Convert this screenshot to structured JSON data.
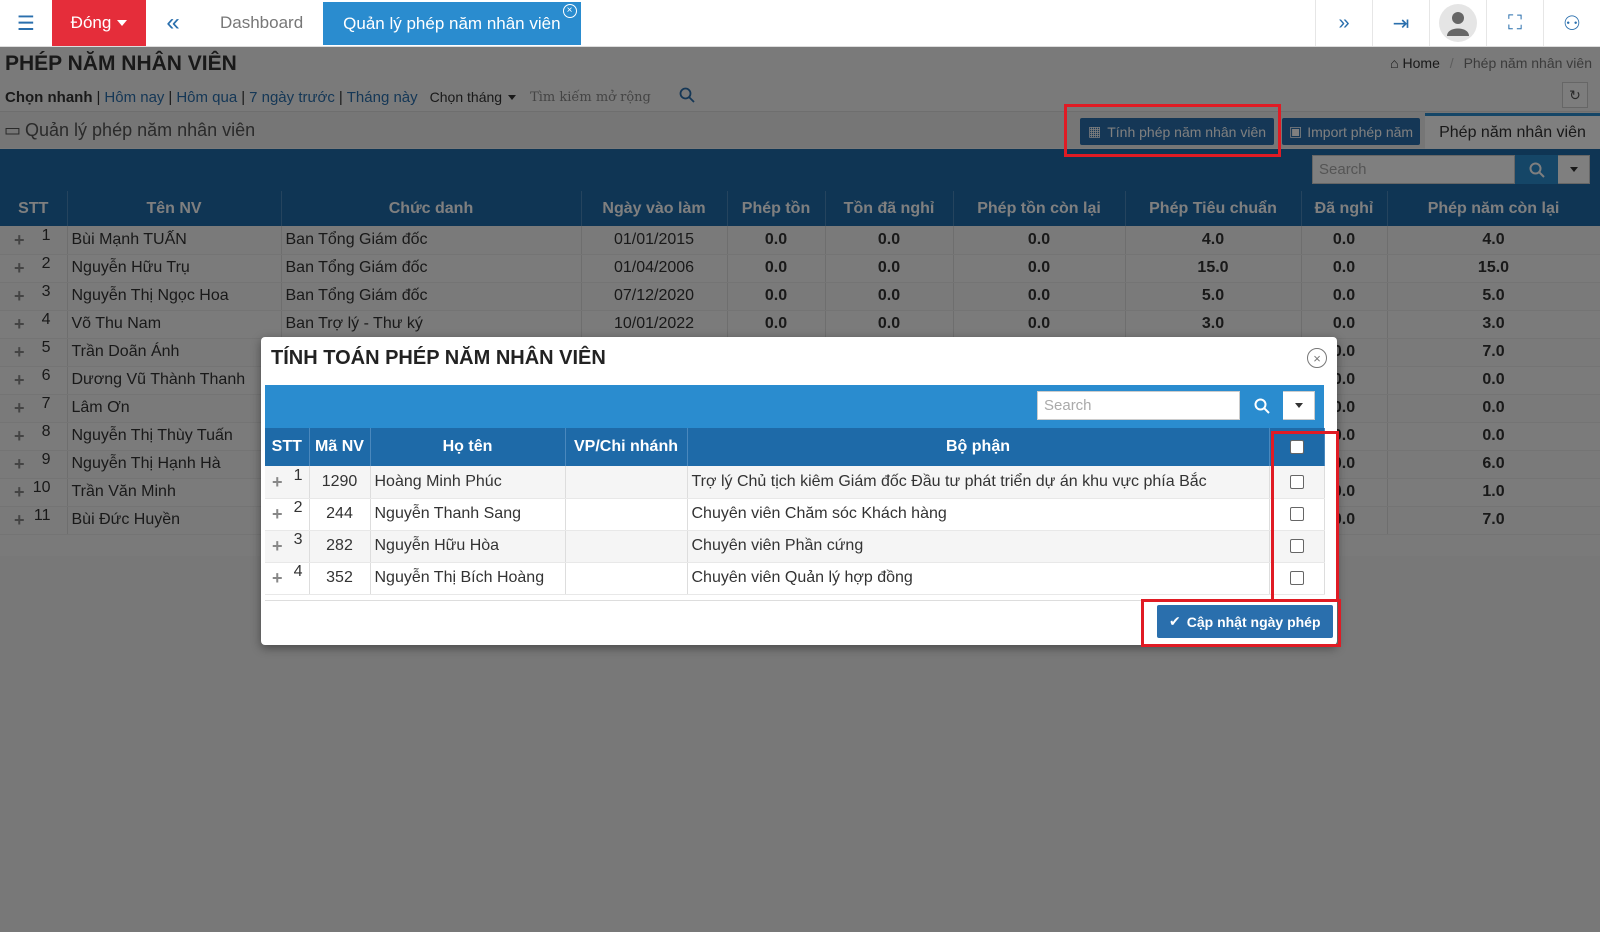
{
  "topbar": {
    "close_label": "Đóng",
    "tabs": [
      "Dashboard",
      "Quản lý phép năm nhân viên"
    ],
    "tab_close_glyph": "×"
  },
  "page": {
    "title": "PHÉP NĂM NHÂN VIÊN",
    "breadcrumb": {
      "home": "Home",
      "current": "Phép năm nhân viên"
    }
  },
  "quick_filter": {
    "label": "Chọn nhanh",
    "links": [
      "Hôm nay",
      "Hôm qua",
      "7 ngày trước",
      "Tháng này"
    ],
    "month_select": "Chọn tháng",
    "extended_search": "Tìm kiếm mở rộng"
  },
  "section": {
    "title": "Quản lý phép năm nhân viên",
    "calc_button": "Tính phép năm nhân viên",
    "import_button": "Import phép năm",
    "tab_label": "Phép năm nhân viên"
  },
  "search": {
    "placeholder": "Search"
  },
  "main_table": {
    "headers": [
      "STT",
      "Tên NV",
      "Chức danh",
      "Ngày vào làm",
      "Phép tồn",
      "Tồn đã nghỉ",
      "Phép tồn còn lại",
      "Phép Tiêu chuẩn",
      "Đã nghỉ",
      "Phép năm còn lại"
    ],
    "rows": [
      {
        "stt": "1",
        "name": "Bùi Mạnh TUẤN",
        "title": "Ban Tổng Giám đốc",
        "date": "01/01/2015",
        "pt": "0.0",
        "tdn": "0.0",
        "ptcl": "0.0",
        "ptc": "4.0",
        "dn": "0.0",
        "pncl": "4.0"
      },
      {
        "stt": "2",
        "name": "Nguyễn Hữu Trụ",
        "title": "Ban Tổng Giám đốc",
        "date": "01/04/2006",
        "pt": "0.0",
        "tdn": "0.0",
        "ptcl": "0.0",
        "ptc": "15.0",
        "dn": "0.0",
        "pncl": "15.0"
      },
      {
        "stt": "3",
        "name": "Nguyễn Thị Ngọc Hoa",
        "title": "Ban Tổng Giám đốc",
        "date": "07/12/2020",
        "pt": "0.0",
        "tdn": "0.0",
        "ptcl": "0.0",
        "ptc": "5.0",
        "dn": "0.0",
        "pncl": "5.0"
      },
      {
        "stt": "4",
        "name": "Võ Thu Nam",
        "title": "Ban Trợ lý - Thư ký",
        "date": "10/01/2022",
        "pt": "0.0",
        "tdn": "0.0",
        "ptcl": "0.0",
        "ptc": "3.0",
        "dn": "0.0",
        "pncl": "3.0"
      },
      {
        "stt": "5",
        "name": "Trần Doãn Ánh",
        "title": "",
        "date": "",
        "pt": "",
        "tdn": "",
        "ptcl": "",
        "ptc": "",
        "dn": "0.0",
        "pncl": "7.0"
      },
      {
        "stt": "6",
        "name": "Dương Vũ Thành Thanh",
        "title": "",
        "date": "",
        "pt": "",
        "tdn": "",
        "ptcl": "",
        "ptc": "",
        "dn": "0.0",
        "pncl": "0.0"
      },
      {
        "stt": "7",
        "name": "Lâm Ơn",
        "title": "",
        "date": "",
        "pt": "",
        "tdn": "",
        "ptcl": "",
        "ptc": "",
        "dn": "0.0",
        "pncl": "0.0"
      },
      {
        "stt": "8",
        "name": "Nguyễn Thị Thùy Tuấn",
        "title": "",
        "date": "",
        "pt": "",
        "tdn": "",
        "ptcl": "",
        "ptc": "",
        "dn": "0.0",
        "pncl": "0.0"
      },
      {
        "stt": "9",
        "name": "Nguyễn Thị Hạnh Hà",
        "title": "",
        "date": "",
        "pt": "",
        "tdn": "",
        "ptcl": "",
        "ptc": "",
        "dn": "0.0",
        "pncl": "6.0"
      },
      {
        "stt": "10",
        "name": "Trần Văn Minh",
        "title": "",
        "date": "",
        "pt": "",
        "tdn": "",
        "ptcl": "",
        "ptc": "",
        "dn": "0.0",
        "pncl": "1.0"
      },
      {
        "stt": "11",
        "name": "Bùi Đức Huyền",
        "title": "",
        "date": "",
        "pt": "",
        "tdn": "",
        "ptcl": "",
        "ptc": "",
        "dn": "0.0",
        "pncl": "7.0"
      }
    ]
  },
  "modal": {
    "title": "TÍNH TOÁN PHÉP NĂM NHÂN VIÊN",
    "headers": [
      "STT",
      "Mã NV",
      "Họ tên",
      "VP/Chi nhánh",
      "Bộ phận"
    ],
    "rows": [
      {
        "stt": "1",
        "code": "1290",
        "name": "Hoàng Minh Phúc",
        "branch": "",
        "dept": "Trợ lý Chủ tịch kiêm Giám đốc Đầu tư phát triển dự án khu vực phía Bắc"
      },
      {
        "stt": "2",
        "code": "244",
        "name": "Nguyễn Thanh Sang",
        "branch": "",
        "dept": "Chuyên viên Chăm sóc Khách hàng"
      },
      {
        "stt": "3",
        "code": "282",
        "name": "Nguyễn Hữu Hòa",
        "branch": "",
        "dept": "Chuyên viên Phần cứng"
      },
      {
        "stt": "4",
        "code": "352",
        "name": "Nguyễn Thị Bích Hoàng",
        "branch": "",
        "dept": "Chuyên viên Quản lý hợp đồng"
      }
    ],
    "update_button": "Cập nhật ngày phép"
  },
  "colors": {
    "accent": "#1e6aa8",
    "danger": "#e52d3a",
    "highlight": "#e01b24"
  }
}
